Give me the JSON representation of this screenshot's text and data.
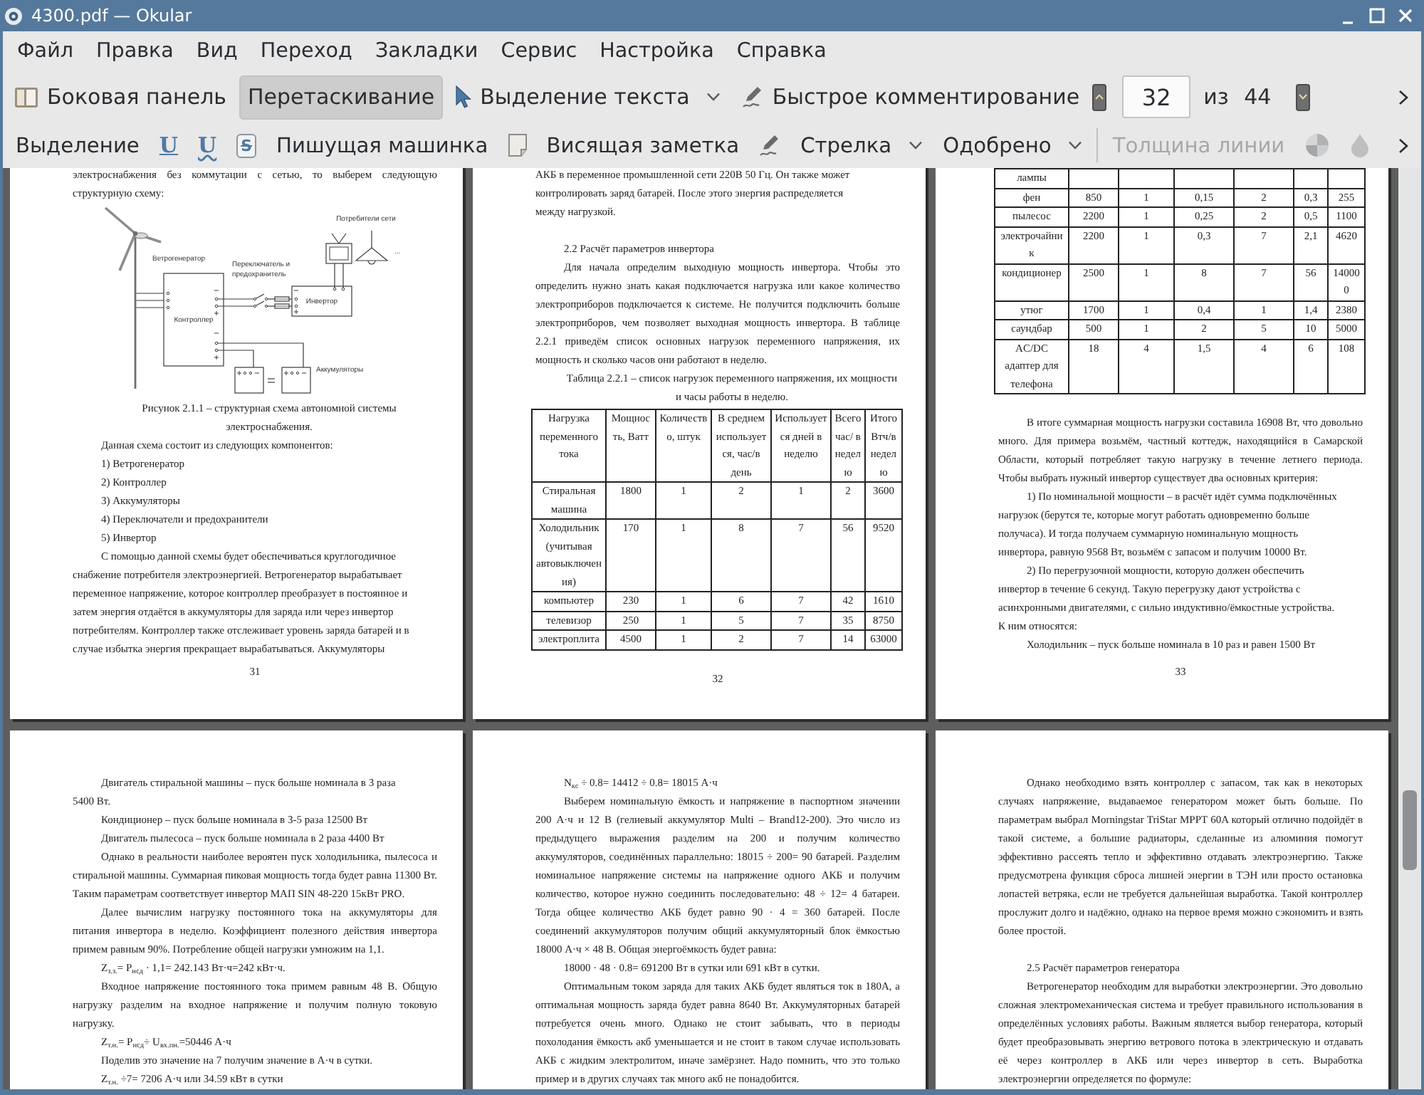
{
  "window": {
    "title": "4300.pdf — Okular"
  },
  "menu_bar": [
    "Файл",
    "Правка",
    "Вид",
    "Переход",
    "Закладки",
    "Сервис",
    "Настройка",
    "Справка"
  ],
  "main_toolbar": [
    {
      "kind": "sidebar",
      "label": "Боковая панель",
      "selected": false
    },
    {
      "kind": "browse",
      "label": "Перетаскивание",
      "selected": true
    },
    {
      "kind": "text_select",
      "label": "Выделение текста",
      "selected": false
    },
    {
      "kind": "quick_annotate",
      "label": "Быстрое комментирование",
      "selected": false
    }
  ],
  "page_navigation": {
    "current_page": "32",
    "page_count": "из 44"
  },
  "annotation_toolbar": [
    {
      "kind": "text",
      "label": "Выделение",
      "disabled": false
    },
    {
      "kind": "underline",
      "label": "U",
      "disabled": false
    },
    {
      "kind": "squiggle",
      "label": "U",
      "disabled": false
    },
    {
      "kind": "strikeout",
      "label": "S",
      "disabled": false
    },
    {
      "kind": "text",
      "label": "Пишущая машинка",
      "disabled": false
    },
    {
      "kind": "note",
      "disabled": false
    },
    {
      "kind": "text",
      "label": "Висящая заметка",
      "disabled": false
    },
    {
      "kind": "pen",
      "disabled": false
    },
    {
      "kind": "menu",
      "label": "Стрелка",
      "disabled": false
    },
    {
      "kind": "menu",
      "label": "Одобрено",
      "disabled": false
    },
    {
      "kind": "separator"
    },
    {
      "kind": "text",
      "label": "Толщина линии",
      "disabled": true
    },
    {
      "kind": "color_wheel",
      "disabled": true
    },
    {
      "kind": "droplet",
      "disabled": true
    }
  ],
  "document": {
    "pages": [
      {
        "number": "31",
        "blocks": [
          {
            "kind": "continuation",
            "text": "электроснабжения без коммутации с сетью, то выберем следующую структурную схему:"
          },
          {
            "kind": "figure",
            "labels": [
              {
                "kind": "consumers",
                "text": "Потребители сети"
              },
              {
                "kind": "more",
                "text": "..."
              },
              {
                "kind": "turbine",
                "text": "Ветрогенератор"
              },
              {
                "kind": "switch",
                "text": "Переключатель и предохранитель"
              },
              {
                "kind": "inverter",
                "text": "Инвертор"
              },
              {
                "kind": "controller",
                "text": "Контроллер"
              },
              {
                "kind": "batteries",
                "text": "Аккумуляторы"
              }
            ]
          },
          {
            "kind": "caption",
            "text": "Рисунок 2.1.1 – структурная схема автономной системы электроснабжения."
          },
          {
            "kind": "ragged",
            "text": "Данная схема состоит из следующих компонентов:"
          },
          {
            "kind": "item",
            "text": "1) Ветрогенератор"
          },
          {
            "kind": "item",
            "text": "2) Контроллер"
          },
          {
            "kind": "item",
            "text": "3) Аккумуляторы"
          },
          {
            "kind": "item",
            "text": "4) Переключатели и предохранители"
          },
          {
            "kind": "item",
            "text": "5) Инвертор"
          },
          {
            "kind": "ragged",
            "text": "С помощью данной схемы будет обеспечиваться круглогодичное снабжение потребителя электроэнергией. Ветрогенератор вырабатывает переменное напряжение, которое контроллер преобразует в постоянное и затем энергия отдаётся в аккумуляторы для заряда или через инвертор потребителям. Контроллер также отслеживает уровень заряда батарей и в случае избытка энергия прекращает вырабатываться. Аккумуляторы"
          }
        ]
      },
      {
        "number": "32",
        "blocks": [
          {
            "kind": "continuation_ragged",
            "text": "АКБ в переменное промышленной сети 220В 50 Гц. Он также может контролировать заряд батарей. После этого энергия распределяется между нагрузкой."
          },
          {
            "kind": "heading",
            "text": "2.2 Расчёт параметров инвертора"
          },
          {
            "kind": "paragraph",
            "text": "Для начала определим выходную мощность инвертора. Чтобы это определить нужно знать какая подключается нагрузка или какое количество электроприборов подключается к системе. Не получится подключить больше электроприборов, чем позволяет выходная мощность инвертора. В таблице 2.2.1 приведём список основных нагрузок переменного напряжения, их мощность и сколько часов они работают в неделю."
          },
          {
            "kind": "caption",
            "text": "Таблица 2.2.1 – список нагрузок переменного напряжения, их мощности и часы работы в неделю."
          },
          {
            "kind": "table",
            "columns": [
              "Нагрузка переменного тока",
              "Мощность, Ватт",
              "Количество, штук",
              "В среднем используется, час/в день",
              "Используется дней в неделю",
              "Всего час/ в неделю",
              "Итого Втч/в неделю"
            ],
            "rows": [
              [
                "Стиральная машина",
                "1800",
                "1",
                "2",
                "1",
                "2",
                "3600"
              ],
              [
                "Холодильник (учитывая автовыключения)",
                "170",
                "1",
                "8",
                "7",
                "56",
                "9520"
              ],
              [
                "компьютер",
                "230",
                "1",
                "6",
                "7",
                "42",
                "1610"
              ],
              [
                "телевизор",
                "250",
                "1",
                "5",
                "7",
                "35",
                "8750"
              ],
              [
                "электроплита",
                "4500",
                "1",
                "2",
                "7",
                "14",
                "63000"
              ]
            ]
          }
        ]
      },
      {
        "number": "33",
        "blocks": [
          {
            "kind": "table",
            "rows": [
              [
                "лампы"
              ],
              [
                "фен",
                "850",
                "1",
                "0,15",
                "2",
                "0,3",
                "255"
              ],
              [
                "пылесос",
                "2200",
                "1",
                "0,25",
                "2",
                "0,5",
                "1100"
              ],
              [
                "электрочайник",
                "2200",
                "1",
                "0,3",
                "7",
                "2,1",
                "4620"
              ],
              [
                "кондиционер",
                "2500",
                "1",
                "8",
                "7",
                "56",
                "140000"
              ],
              [
                "утюг",
                "1700",
                "1",
                "0,4",
                "1",
                "1,4",
                "2380"
              ],
              [
                "саундбар",
                "500",
                "1",
                "2",
                "5",
                "10",
                "5000"
              ],
              [
                "AC/DC адаптер для телефона",
                "18",
                "4",
                "1,5",
                "4",
                "6",
                "108"
              ]
            ]
          },
          {
            "kind": "paragraph",
            "text": "В итоге суммарная мощность нагрузки составила 16908 Вт, что довольно много. Для примера возьмём, частный коттедж, находящийся в Самарской Области, который потребляет такую нагрузку в течение летнего периода. Чтобы выбрать нужный инвертор существует два основных критерия:"
          },
          {
            "kind": "ragged",
            "text": "1) По номинальной мощности – в расчёт идёт сумма подключённых нагрузок (берутся те, которые могут работать одновременно больше получаса). И тогда получаем суммарную номинальную мощность инвертора, равную 9568 Вт, возьмём с запасом и получим 10000 Вт."
          },
          {
            "kind": "ragged",
            "text": "2) По перегрузочной мощности, которую должен обеспечить инвертор в течение 6 секунд. Такую перегрузку дают устройства с асинхронными двигателями, с сильно индуктивно/ёмкостные устройства.  К ним относятся:"
          },
          {
            "kind": "ragged",
            "text": "Холодильник – пуск больше номинала в 10 раз и равен 1500 Вт"
          }
        ]
      },
      {
        "blocks": [
          {
            "kind": "ragged",
            "text": "Двигатель стиральной машины – пуск больше номинала в 3 раза 5400 Вт."
          },
          {
            "kind": "ragged",
            "text": "Кондиционер – пуск больше номинала в 3-5 раза 12500 Вт"
          },
          {
            "kind": "ragged",
            "text": "Двигатель пылесоса – пуск больше номинала в 2 раза 4400 Вт"
          },
          {
            "kind": "paragraph",
            "text": "Однако в реальности наиболее вероятен пуск холодильника, пылесоса и стиральной машины. Суммарная пиковая мощность тогда будет равна 11300 Вт. Таким параметрам соответствует инвертор МАП SIN 48-220 15кВт PRO."
          },
          {
            "kind": "paragraph",
            "text": "Далее вычислим нагрузку постоянного тока на аккумуляторы для питания инвертора в неделю. Коэффициент полезного действия инвертора примем равным 90%. Потребление общей нагрузки умножим на 1,1."
          },
          {
            "kind": "formula",
            "text": "Z$_{з.з.}$= P$_{нсд}$ · 1,1= 242.143 Вт·ч=242 кВт·ч."
          },
          {
            "kind": "paragraph",
            "text": "Входное напряжение постоянного тока примем равным 48 В. Общую нагрузку разделим на входное напряжение и получим полную токовую нагрузку."
          },
          {
            "kind": "formula",
            "text": "Z$_{т.н.}$= P$_{нсд}$÷ U$_{вх.пн.}$=50446 А·ч"
          },
          {
            "kind": "ragged",
            "text": "Поделив это значение на 7 получим значение в А·ч в сутки."
          },
          {
            "kind": "formula",
            "text": "Z$_{т.н.}$ ÷7= 7206 А·ч или 34.59 кВт в сутки"
          }
        ]
      },
      {
        "blocks": [
          {
            "kind": "formula",
            "text": "N$_{кс}$ ÷ 0.8= 14412 ÷ 0.8= 18015 А·ч"
          },
          {
            "kind": "paragraph",
            "text": "Выберем номинальную ёмкость и напряжение в паспортном значении 200 А·ч и 12 В (гелиевый аккумулятор Multi – Brand12-200).  Это число из предыдущего выражения разделим на 200 и получим количество аккумуляторов, соединённых параллельно: 18015 ÷ 200= 90 батарей. Разделим номинальное напряжение системы на напряжение одного АКБ и получим количество, которое нужно соединить последовательно: 48 ÷ 12= 4 батареи. Тогда общее количество АКБ будет равно 90 · 4 = 360 батарей. После соединений аккумуляторов получим общий аккумуляторный блок ёмкостью 18000 А·ч × 48 В. Общая энергоёмкость будет равна:"
          },
          {
            "kind": "formula",
            "text": "18000 · 48 · 0.8= 691200 Вт в сутки или 691 кВт в сутки."
          },
          {
            "kind": "paragraph",
            "text": "Оптимальным током заряда для таких АКБ будет являться ток в 180А, а оптимальная мощность заряда будет равна 8640 Вт. Аккумуляторных батарей потребуется очень много. Однако не стоит забывать, что в периоды похолодания ёмкость акб уменьшается и не стоит в таком случае использовать АКБ с жидким электролитом, иначе замёрзнет. Надо помнить, что это только пример и в других случаях так много акб не понадобится."
          }
        ]
      },
      {
        "blocks": [
          {
            "kind": "paragraph",
            "text": "Однако необходимо взять контроллер с запасом, так как в некоторых случаях напряжение, выдаваемое генератором может быть больше. По параметрам выбрал Morningstar TriStar MPPT 60A который отлично подойдёт в такой системе, а большие радиаторы, сделанные из алюминия помогут эффективно рассеять тепло и эффективно отдавать электроэнергию. Также предусмотрена функция сброса лишней энергии в ТЭН или просто остановка лопастей ветряка, если не требуется дальнейшая выработка. Такой контроллер прослужит долго и надёжно, однако на первое время можно сэкономить и взять более простой."
          },
          {
            "kind": "heading",
            "text": "2.5 Расчёт параметров генератора"
          },
          {
            "kind": "paragraph",
            "text": "Ветрогенератор необходим для выработки электроэнергии. Это довольно сложная электромеханическая система и требует правильного использования в определённых условиях работы. Важным является выбор генератора, который будет преобразовывать энергию ветрового потока в электрическую и отдавать её через контроллер в АКБ или через инвертор в сеть. Выработка электроэнергии определяется по формуле:"
          }
        ]
      }
    ]
  }
}
